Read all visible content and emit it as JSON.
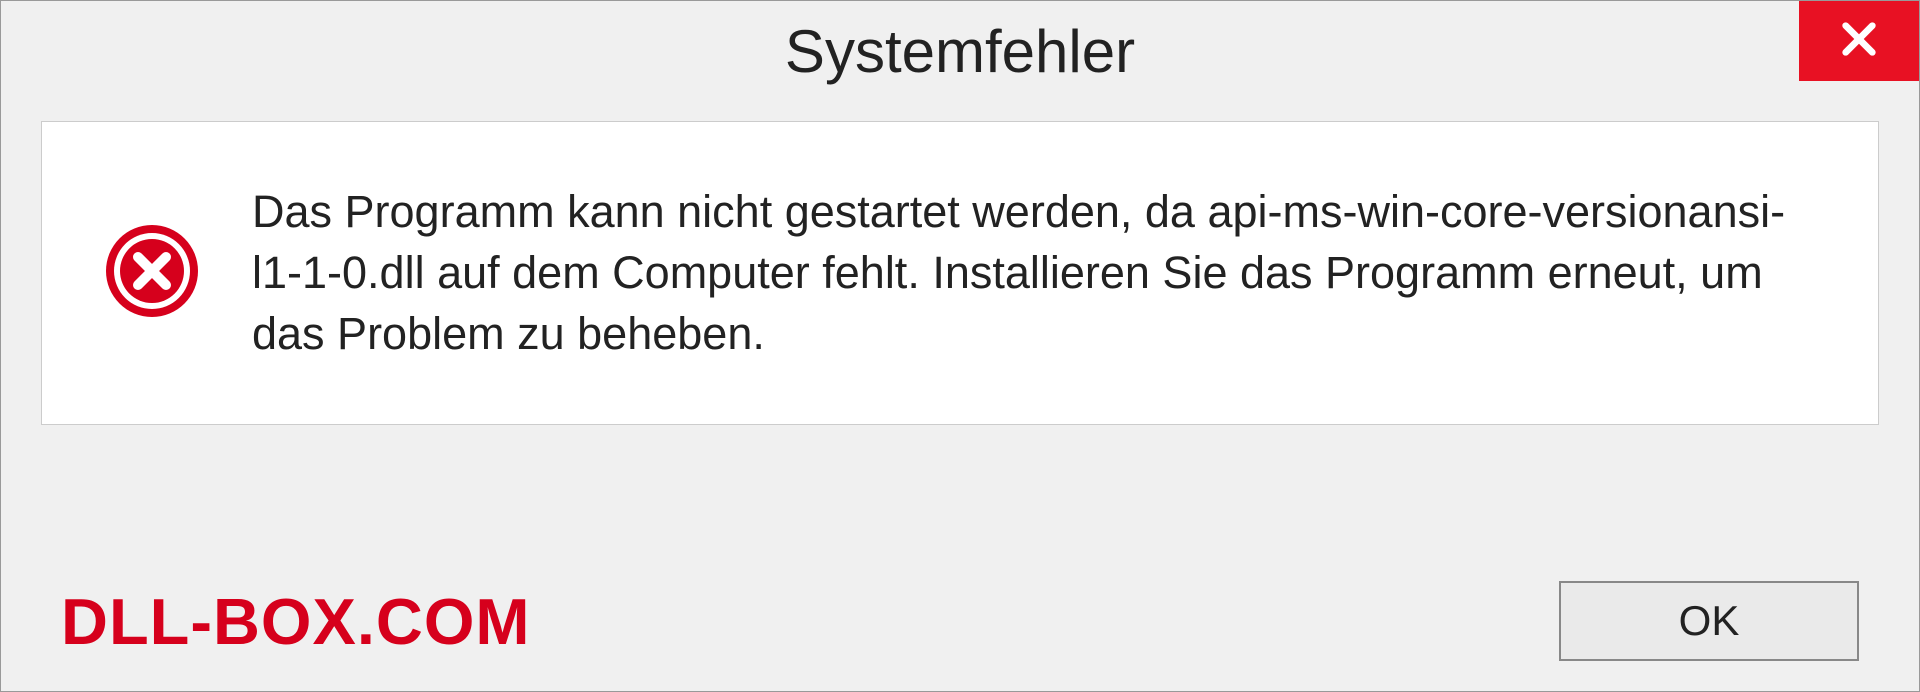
{
  "dialog": {
    "title": "Systemfehler",
    "message": "Das Programm kann nicht gestartet werden, da api-ms-win-core-versionansi-l1-1-0.dll auf dem Computer fehlt. Installieren Sie das Programm erneut, um das Problem zu beheben.",
    "ok_label": "OK"
  },
  "watermark": "DLL-BOX.COM",
  "colors": {
    "close_bg": "#e81123",
    "error_icon": "#d6001c",
    "watermark": "#d6001c"
  }
}
